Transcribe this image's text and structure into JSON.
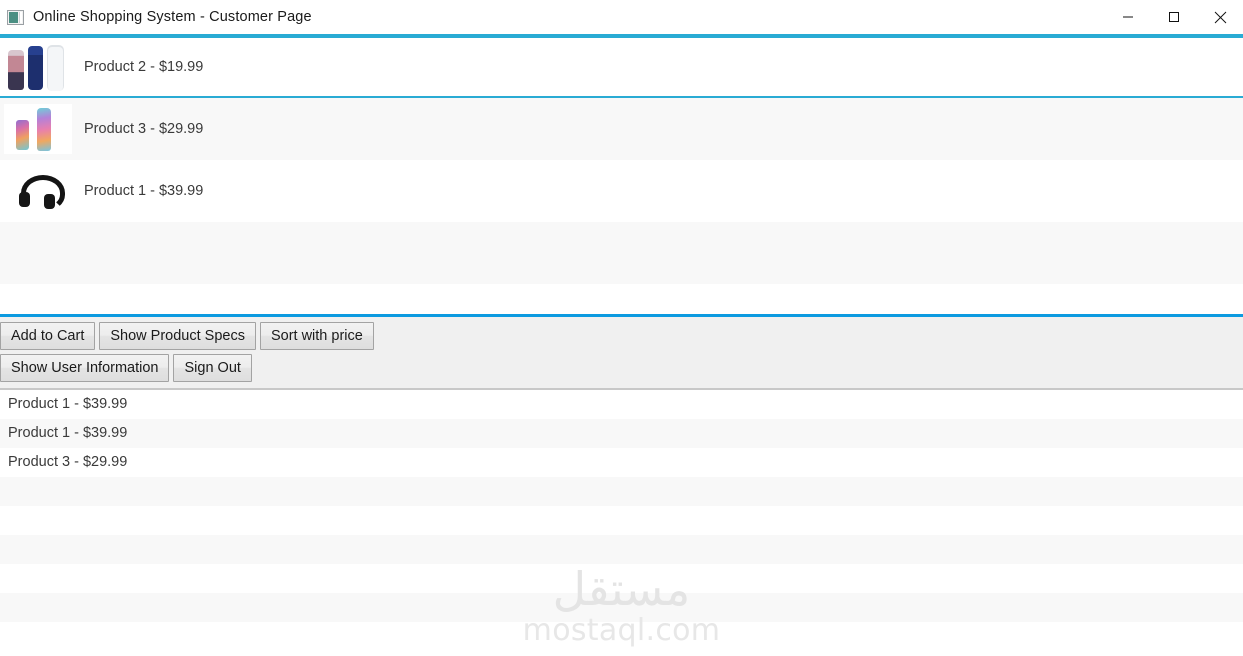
{
  "window": {
    "title": "Online Shopping System - Customer Page",
    "icon": "app-window-icon",
    "controls": {
      "minimize": "minimize-icon",
      "maximize": "maximize-icon",
      "close": "close-icon"
    }
  },
  "accent_colors": {
    "list_border": "#29abd4",
    "panel_top_rule": "#0c9ae0",
    "panel_bottom_rule": "#c8c8c8",
    "panel_background": "#f0f0f0",
    "row_alt_background": "#f8f8f8",
    "text": "#3a3a3a",
    "watermark": "#e4e4e4"
  },
  "product_list": {
    "name": "product-catalog-list",
    "selected_index": 0,
    "items": [
      {
        "label": "Product 2 - $19.99",
        "thumb": "toiletries-bottles-thumbnail",
        "selected": true
      },
      {
        "label": "Product 3 - $29.99",
        "thumb": "iridescent-water-bottles-thumbnail",
        "selected": false
      },
      {
        "label": "Product 1 - $39.99",
        "thumb": "black-headphones-thumbnail",
        "selected": false
      }
    ]
  },
  "buttons": {
    "row1": [
      {
        "label": "Add to Cart",
        "name": "add-to-cart-button"
      },
      {
        "label": "Show Product Specs",
        "name": "show-product-specs-button"
      },
      {
        "label": "Sort with price",
        "name": "sort-with-price-button"
      }
    ],
    "row2": [
      {
        "label": "Show User Information",
        "name": "show-user-information-button"
      },
      {
        "label": "Sign Out",
        "name": "sign-out-button"
      }
    ]
  },
  "cart_list": {
    "name": "shopping-cart-list",
    "items": [
      {
        "label": "Product 1 - $39.99"
      },
      {
        "label": "Product 1 - $39.99"
      },
      {
        "label": "Product 3 - $29.99"
      }
    ]
  },
  "watermark": {
    "arabic": "مستقل",
    "latin": "mostaql.com"
  }
}
